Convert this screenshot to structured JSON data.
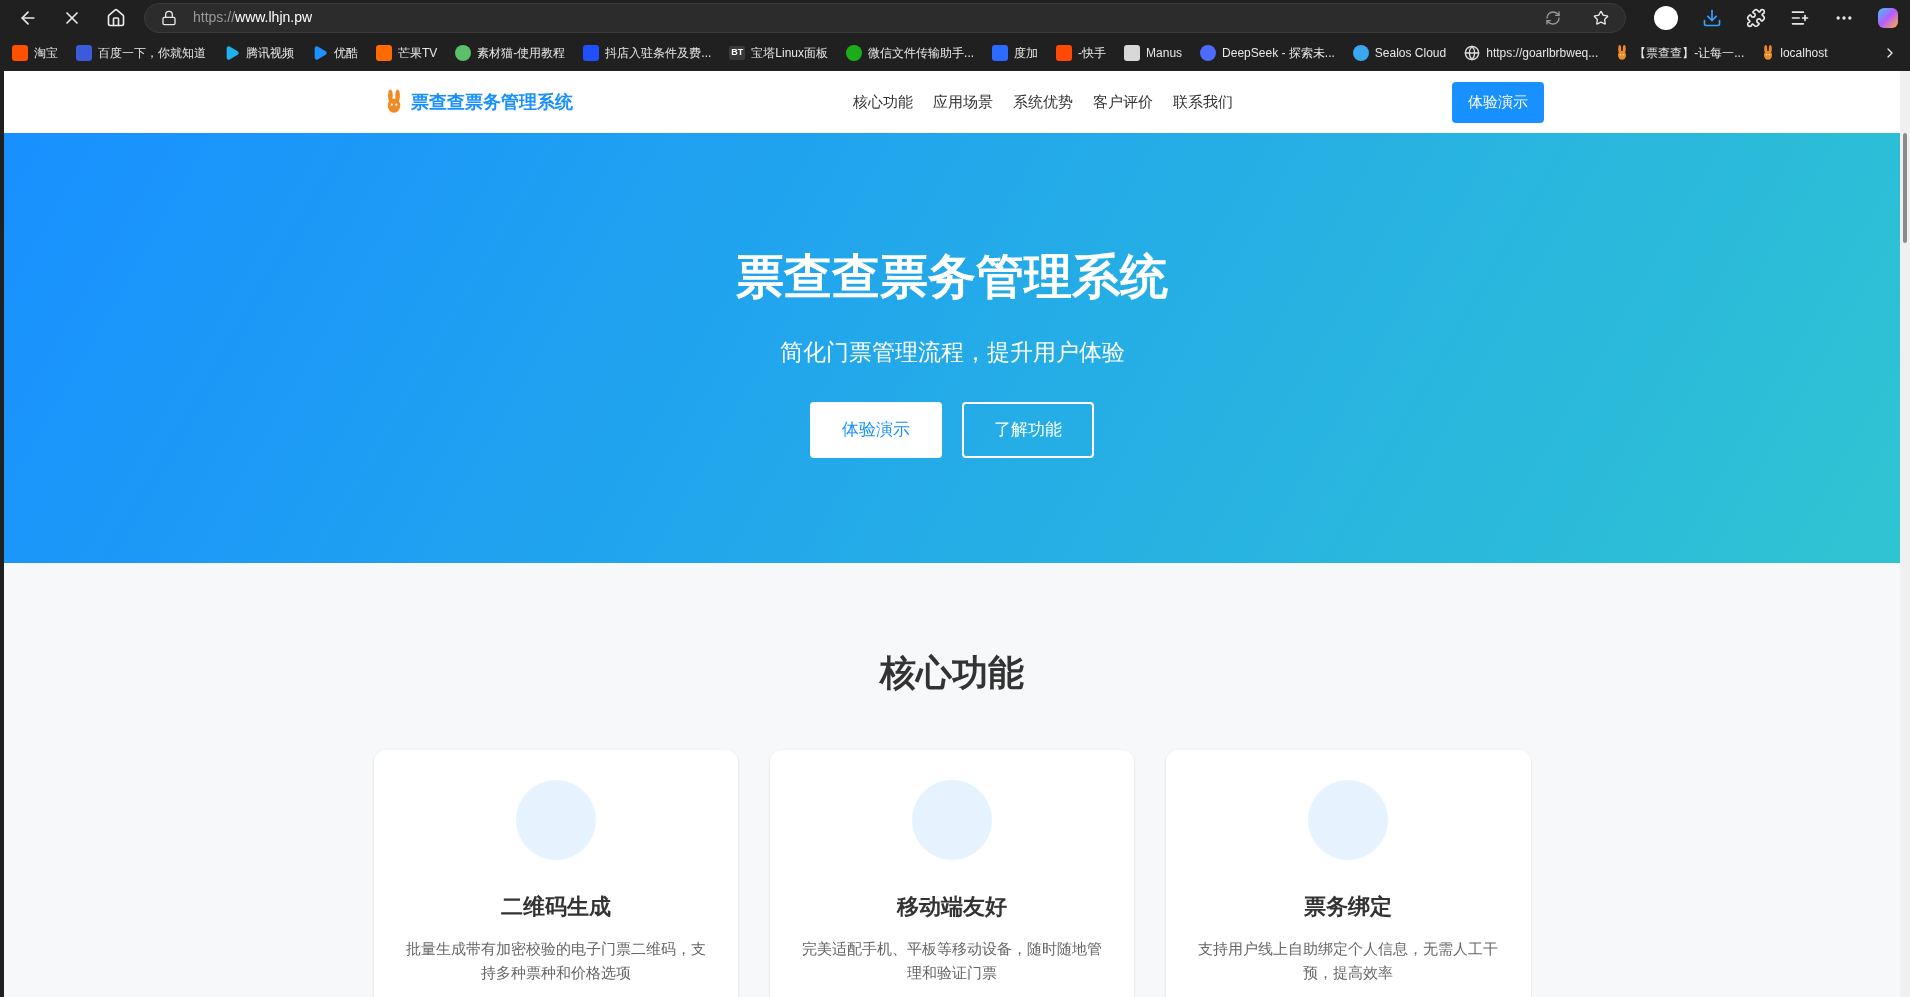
{
  "browser": {
    "url_scheme": "https://",
    "url_host": "www.lhjn.pw",
    "bookmarks": [
      {
        "label": "淘宝",
        "kind": "square",
        "color": "#ff5000"
      },
      {
        "label": "百度一下，你就知道",
        "kind": "square",
        "color": "#3b5bdb"
      },
      {
        "label": "腾讯视频",
        "kind": "play",
        "color": "#20b2f0"
      },
      {
        "label": "优酷",
        "kind": "play",
        "color": "#1e90ff"
      },
      {
        "label": "芒果TV",
        "kind": "square",
        "color": "#ff6a00"
      },
      {
        "label": "素材猫-使用教程",
        "kind": "circle",
        "color": "#5cbf6a"
      },
      {
        "label": "抖店入驻条件及费...",
        "kind": "square",
        "color": "#1f4fff"
      },
      {
        "label": "宝塔Linux面板",
        "kind": "text",
        "color": "#3a3a3a",
        "mark": "BT"
      },
      {
        "label": "微信文件传输助手...",
        "kind": "circle",
        "color": "#1aad19"
      },
      {
        "label": "度加",
        "kind": "square",
        "color": "#2b6bff"
      },
      {
        "label": "-快手",
        "kind": "square",
        "color": "#ff4906"
      },
      {
        "label": "Manus",
        "kind": "square",
        "color": "#d8d8d8"
      },
      {
        "label": "DeepSeek - 探索未...",
        "kind": "circle",
        "color": "#4d6bfe"
      },
      {
        "label": "Sealos Cloud",
        "kind": "circle",
        "color": "#3aa7f0"
      },
      {
        "label": "https://goarlbrbweq...",
        "kind": "globe",
        "color": "#e0e0e0"
      },
      {
        "label": "【票查查】-让每一...",
        "kind": "rabbit",
        "color": "#f08a24"
      },
      {
        "label": "localhost",
        "kind": "rabbit",
        "color": "#f08a24"
      }
    ]
  },
  "header": {
    "brand": "票查查票务管理系统",
    "nav": [
      {
        "label": "核心功能"
      },
      {
        "label": "应用场景"
      },
      {
        "label": "系统优势"
      },
      {
        "label": "客户评价"
      },
      {
        "label": "联系我们"
      }
    ],
    "cta": "体验演示"
  },
  "hero": {
    "title": "票查查票务管理系统",
    "subtitle": "简化门票管理流程，提升用户体验",
    "buttons": [
      {
        "label": "体验演示",
        "kind": "solid"
      },
      {
        "label": "了解功能",
        "kind": "outline"
      }
    ]
  },
  "features": {
    "title": "核心功能",
    "cards": [
      {
        "title": "二维码生成",
        "text": "批量生成带有加密校验的电子门票二维码，支持多种票种和价格选项"
      },
      {
        "title": "移动端友好",
        "text": "完美适配手机、平板等移动设备，随时随地管理和验证门票"
      },
      {
        "title": "票务绑定",
        "text": "支持用户线上自助绑定个人信息，无需人工干预，提高效率"
      }
    ]
  }
}
